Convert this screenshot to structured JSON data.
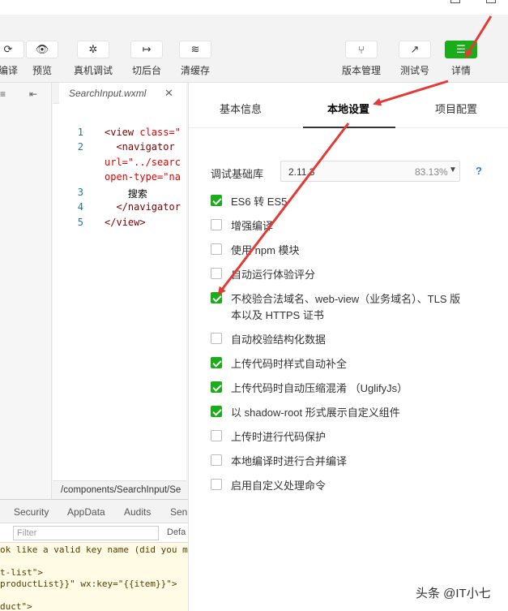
{
  "toolbar": {
    "left_tools": [
      {
        "label": "编译",
        "icon": "compile-icon",
        "glyph": "⟳"
      },
      {
        "label": "预览",
        "icon": "eye-icon",
        "glyph": "👁"
      },
      {
        "label": "真机调试",
        "icon": "bug-icon",
        "glyph": "✲"
      },
      {
        "label": "切后台",
        "icon": "background-icon",
        "glyph": "↦"
      },
      {
        "label": "清缓存",
        "icon": "layers-icon",
        "glyph": "≋"
      }
    ],
    "right_tools": [
      {
        "label": "版本管理",
        "icon": "version-icon",
        "glyph": "⑂"
      },
      {
        "label": "测试号",
        "icon": "external-link-icon",
        "glyph": "↗"
      },
      {
        "label": "详情",
        "icon": "menu-icon",
        "glyph": "☰"
      }
    ]
  },
  "editor": {
    "tab_name": "SearchInput.wxml",
    "close_glyph": "✕",
    "code_lines": [
      {
        "num": "1",
        "parts": [
          {
            "t": "<view ",
            "c": ""
          },
          {
            "t": "class=\"",
            "c": "attr"
          }
        ]
      },
      {
        "num": "2",
        "parts": [
          {
            "t": "  <navigator",
            "c": ""
          }
        ]
      },
      {
        "num": "",
        "parts": [
          {
            "t": "url=\"../searc",
            "c": "attr"
          }
        ]
      },
      {
        "num": "",
        "parts": [
          {
            "t": "open-type=\"na",
            "c": "attr"
          }
        ]
      },
      {
        "num": "3",
        "parts": [
          {
            "t": "    搜索",
            "c": "txt"
          }
        ]
      },
      {
        "num": "4",
        "parts": [
          {
            "t": "  </navigator",
            "c": ""
          }
        ]
      },
      {
        "num": "5",
        "parts": [
          {
            "t": "</view>",
            "c": ""
          }
        ]
      }
    ],
    "path": "/components/SearchInput/Se"
  },
  "devtools": {
    "tabs": [
      "Security",
      "AppData",
      "Audits",
      "Sen"
    ],
    "filter_placeholder": "Filter",
    "filter_default": "Defa",
    "console_lines": [
      "ok like a valid key name (did you m",
      "",
      "t-list\">",
      "productList}}\" wx:key=\"{{item}}\">",
      "",
      "duct\">"
    ]
  },
  "details": {
    "tabs": [
      "基本信息",
      "本地设置",
      "项目配置"
    ],
    "active_tab": 1,
    "base_lib_label": "调试基础库",
    "base_lib_version": "2.11.3",
    "base_lib_percent": "83.13%",
    "help_label": "?",
    "options": [
      {
        "label": "ES6 转 ES5",
        "checked": true
      },
      {
        "label": "增强编译",
        "checked": false
      },
      {
        "label": "使用 npm 模块",
        "checked": false
      },
      {
        "label": "自动运行体验评分",
        "checked": false
      },
      {
        "label": "不校验合法域名、web-view（业务域名）、TLS 版",
        "label2": "本以及 HTTPS 证书",
        "checked": true
      },
      {
        "label": "自动校验结构化数据",
        "checked": false
      },
      {
        "label": "上传代码时样式自动补全",
        "checked": true
      },
      {
        "label": "上传代码时自动压缩混淆 （UglifyJs）",
        "checked": true
      },
      {
        "label": "以 shadow-root 形式展示自定义组件",
        "checked": true
      },
      {
        "label": "上传时进行代码保护",
        "checked": false
      },
      {
        "label": "本地编译时进行合并编译",
        "checked": false
      },
      {
        "label": "启用自定义处理命令",
        "checked": false
      }
    ]
  },
  "colors": {
    "accent": "#1aad19",
    "annotation": "#e53935",
    "help": "#2d7be5"
  },
  "watermark": "头条 @IT小七"
}
